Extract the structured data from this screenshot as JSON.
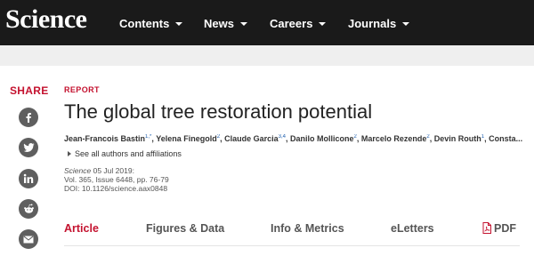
{
  "header": {
    "logo": "Science",
    "nav": [
      {
        "label": "Contents"
      },
      {
        "label": "News"
      },
      {
        "label": "Careers"
      },
      {
        "label": "Journals"
      }
    ]
  },
  "share": {
    "label": "SHARE",
    "buttons": [
      "facebook-icon",
      "twitter-icon",
      "linkedin-icon",
      "reddit-icon",
      "email-icon"
    ]
  },
  "article": {
    "type": "REPORT",
    "title": "The global tree restoration potential",
    "authors": [
      {
        "name": "Jean-Francois Bastin",
        "sup": "1,*"
      },
      {
        "name": "Yelena Finegold",
        "sup": "2"
      },
      {
        "name": "Claude Garcia",
        "sup": "3,4"
      },
      {
        "name": "Danilo Mollicone",
        "sup": "2"
      },
      {
        "name": "Marcelo Rezende",
        "sup": "2"
      },
      {
        "name": "Devin Routh",
        "sup": "1"
      },
      {
        "name": "Consta...",
        "sup": ""
      }
    ],
    "see_all": "See all authors and affiliations",
    "citation": {
      "journal": "Science",
      "date": " 05 Jul 2019:",
      "volume": "Vol. 365, Issue 6448, pp. 76-79",
      "doi": "DOI: 10.1126/science.aax0848"
    }
  },
  "tabs": [
    {
      "label": "Article",
      "active": true
    },
    {
      "label": "Figures & Data",
      "active": false
    },
    {
      "label": "Info & Metrics",
      "active": false
    },
    {
      "label": "eLetters",
      "active": false
    },
    {
      "label": "PDF",
      "active": false
    }
  ],
  "colors": {
    "accent": "#c4122f",
    "nav_bg": "#1a1a1a",
    "icon_bg": "#5f5f5f"
  }
}
